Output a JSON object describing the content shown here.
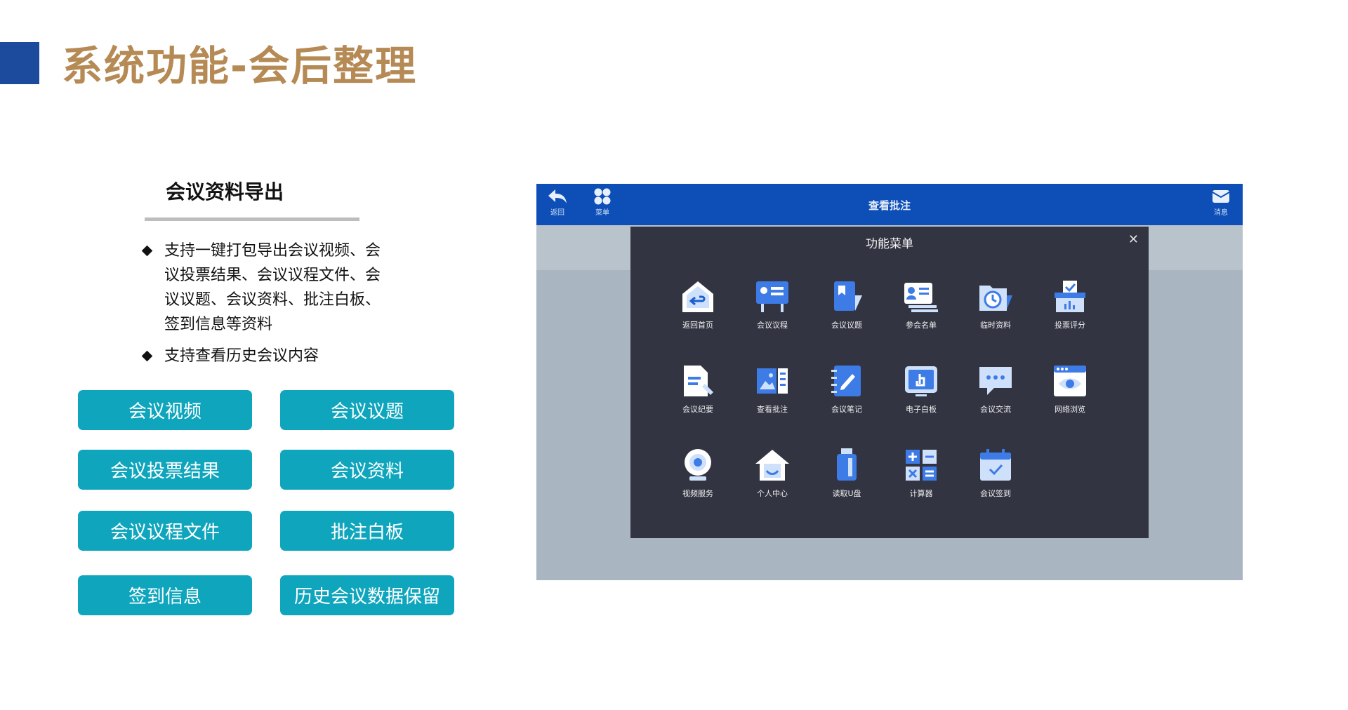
{
  "slide": {
    "title": "系统功能-会后整理",
    "section_title": "会议资料导出",
    "bullets": [
      "支持一键打包导出会议视频、会议投票结果、会议议程文件、会议议题、会议资料、批注白板、签到信息等资料",
      "支持查看历史会议内容"
    ],
    "tags": [
      "会议视频",
      "会议议题",
      "会议投票结果",
      "会议资料",
      "会议议程文件",
      "批注白板",
      "签到信息",
      "历史会议数据保留"
    ],
    "colors": {
      "title": "#b58a55",
      "accent": "#1c4a9c",
      "tag": "#0fa6bd"
    }
  },
  "screen": {
    "topbar": {
      "back_label": "返回",
      "menu_label": "菜单",
      "title": "查看批注",
      "message_label": "消息"
    },
    "panel": {
      "title": "功能菜单",
      "close_icon": "close-icon",
      "apps": [
        {
          "label": "返回首页",
          "icon": "home-back-icon"
        },
        {
          "label": "会议议程",
          "icon": "agenda-icon"
        },
        {
          "label": "会议议题",
          "icon": "topic-icon"
        },
        {
          "label": "参会名单",
          "icon": "attendee-list-icon"
        },
        {
          "label": "临时资料",
          "icon": "temp-files-icon"
        },
        {
          "label": "投票评分",
          "icon": "vote-icon"
        },
        {
          "label": "会议纪要",
          "icon": "minutes-icon"
        },
        {
          "label": "查看批注",
          "icon": "annotation-icon"
        },
        {
          "label": "会议笔记",
          "icon": "notes-icon"
        },
        {
          "label": "电子白板",
          "icon": "whiteboard-icon"
        },
        {
          "label": "会议交流",
          "icon": "chat-icon"
        },
        {
          "label": "网络浏览",
          "icon": "browser-icon"
        },
        {
          "label": "视频服务",
          "icon": "video-icon"
        },
        {
          "label": "个人中心",
          "icon": "user-center-icon"
        },
        {
          "label": "读取U盘",
          "icon": "usb-icon"
        },
        {
          "label": "计算器",
          "icon": "calculator-icon"
        },
        {
          "label": "会议签到",
          "icon": "sign-in-icon"
        }
      ]
    }
  }
}
